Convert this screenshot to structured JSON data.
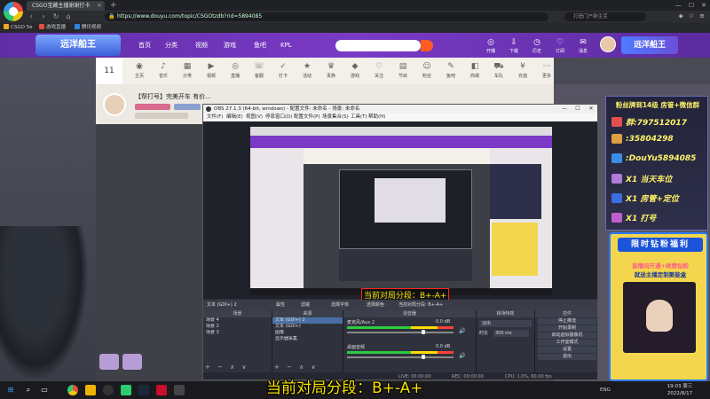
{
  "browser": {
    "tab_title": "CSGO宝藏主播谢谢打卡",
    "tab_close": "×",
    "tab_add": "+",
    "url": "https://www.douyu.com/topic/CSGOtzdb?rid=5894085",
    "search_placeholder": "打造门户新生活",
    "back": "‹",
    "forward": "›",
    "reload": "↻",
    "home": "⌂",
    "bookmarks": [
      "CSGO 5e",
      "游戏直播",
      "腾讯视频"
    ],
    "window_controls": [
      "—",
      "☐",
      "✕"
    ]
  },
  "site": {
    "brand": "远洋船王",
    "logo_text": "远洋船王",
    "nav": [
      "首页",
      "分类",
      "视频",
      "游戏",
      "鱼吧",
      "KPL"
    ],
    "date_day": "11",
    "categories": [
      "主页",
      "音乐",
      "分类",
      "视频",
      "直播",
      "客服",
      "打卡",
      "活动",
      "贵族",
      "游戏",
      "关注",
      "节目",
      "粉丝",
      "鱼吧",
      "商城",
      "车队",
      "充值",
      "更多"
    ],
    "stream_title": "【帮打号】完美开车 有价...",
    "header_icons": [
      "开播",
      "下载",
      "历史",
      "订阅",
      "消息"
    ]
  },
  "obs": {
    "title": "OBS 27.1.3 (64-bit, windows) - 配置文件: 未命名 - 场景: 未命名",
    "menu": [
      "文件(F)",
      "编辑(E)",
      "视图(V)",
      "停靠窗口(D)",
      "配置文件(P)",
      "场景集合(S)",
      "工具(T)",
      "帮助(H)"
    ],
    "controls": [
      "—",
      "☐",
      "✕"
    ],
    "toolbar": [
      "文本 (GDI+) 2",
      "属性",
      "滤镜",
      "选择字体",
      "选择颜色",
      "当前对局分段: B+-A+"
    ],
    "docks": {
      "scenes_title": "场景",
      "scenes": [
        "场景 4",
        "场景 2",
        "场景 3"
      ],
      "sources_title": "来源",
      "sources": [
        "文本 (GDI+) 2",
        "文本 (GDI+)",
        "图像",
        "显示器采集"
      ],
      "mixer_title": "混音器",
      "mixer": [
        {
          "name": "麦克风/Aux 2",
          "db": "0.0 dB",
          "level": 0.72
        },
        {
          "name": "桌面音频",
          "db": "0.0 dB",
          "level": 0.72
        }
      ],
      "transitions_title": "转场特效",
      "transition_value": "淡出",
      "duration_label": "时长",
      "duration_value": "300 ms",
      "controls_title": "控件",
      "control_buttons": [
        "停止推流",
        "开始录制",
        "启动虚拟摄像机",
        "工作室模式",
        "设置",
        "退出"
      ],
      "footer": "+ − ∧ ∨"
    },
    "status": {
      "live": "LIVE: 00:00:00",
      "rec": "REC: 00:00:00",
      "cpu": "CPU: 1.0%, 60.00 fps"
    },
    "preview_caption": "当前对局分段：B+-A+"
  },
  "overlay": {
    "fans_title": "粉丝牌到14级 房管+微信群",
    "lines": [
      {
        "text": "群:797512017",
        "color": "#e34f4f"
      },
      {
        "text": ":35804298",
        "color": "#e0a040"
      },
      {
        "text": ":DouYu5894085",
        "color": "#3a8ee6"
      },
      {
        "text": "X1  当天车位",
        "color": "#b07ad8"
      },
      {
        "text": "X1  房管+定位",
        "color": "#3b6fe0"
      },
      {
        "text": "X1  打号",
        "color": "#c05fd0"
      }
    ],
    "welfare_title": "限时钻粉福利",
    "welfare_sub1": "直播间开通+续费钻粉",
    "welfare_sub2": "就送主播定制聚能盒"
  },
  "caption": "当前对局分段：B+-A+",
  "taskbar": {
    "tray_text": "ENG",
    "time": "19:03 周三",
    "date": "2022/8/17"
  },
  "colors": {
    "caption_yellow": "#f7e300",
    "douyu_purple": "#6a32b6",
    "obs_dark": "#2b2e38"
  }
}
